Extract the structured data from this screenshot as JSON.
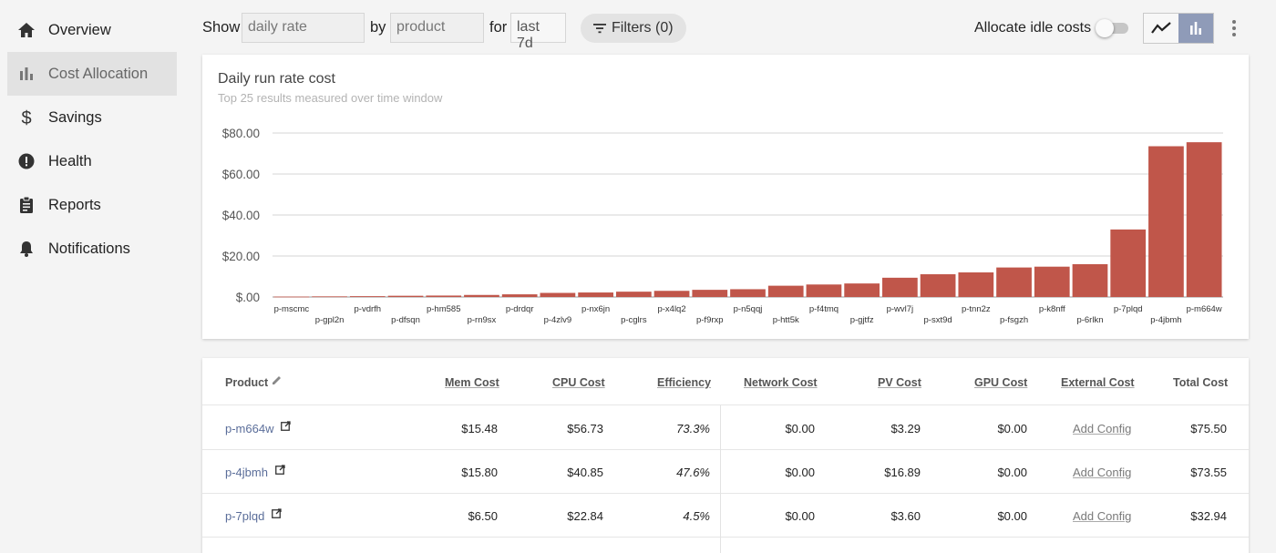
{
  "sidebar": {
    "items": [
      {
        "label": "Overview",
        "icon": "home-icon",
        "active": false
      },
      {
        "label": "Cost Allocation",
        "icon": "bar-chart-icon",
        "active": true
      },
      {
        "label": "Savings",
        "icon": "dollar-icon",
        "active": false
      },
      {
        "label": "Health",
        "icon": "alert-circle-icon",
        "active": false
      },
      {
        "label": "Reports",
        "icon": "clipboard-icon",
        "active": false
      },
      {
        "label": "Notifications",
        "icon": "bell-icon",
        "active": false
      }
    ]
  },
  "toolbar": {
    "show_label": "Show",
    "show_value": "daily rate",
    "by_label": "by",
    "by_value": "product",
    "for_label": "for",
    "for_value": "last 7d",
    "filters_label": "Filters (0)",
    "idle_label": "Allocate idle costs",
    "idle_enabled": false,
    "view_selected": "bar"
  },
  "chart": {
    "title": "Daily run rate cost",
    "subtitle": "Top 25 results measured over time window"
  },
  "chart_data": {
    "type": "bar",
    "categories": [
      "p-mscmc",
      "p-gpl2n",
      "p-vdrfh",
      "p-dfsqn",
      "p-hm585",
      "p-rn9sx",
      "p-drdqr",
      "p-4zlv9",
      "p-nx6jn",
      "p-cglrs",
      "p-x4lq2",
      "p-f9rxp",
      "p-n5qqj",
      "p-htt5k",
      "p-f4tmq",
      "p-gjtfz",
      "p-wvl7j",
      "p-sxt9d",
      "p-tnn2z",
      "p-fsgzh",
      "p-k8nff",
      "p-6rlkn",
      "p-7plqd",
      "p-4jbmh",
      "p-m664w"
    ],
    "values": [
      0.2,
      0.3,
      0.4,
      0.6,
      0.7,
      1.0,
      1.3,
      2.0,
      2.2,
      2.6,
      3.0,
      3.5,
      3.8,
      5.5,
      6.1,
      6.6,
      9.4,
      11.1,
      12.0,
      14.4,
      14.8,
      16.0,
      32.94,
      73.55,
      75.5
    ],
    "y_ticks": [
      "$.00",
      "$20.00",
      "$40.00",
      "$60.00",
      "$80.00"
    ],
    "ylim": [
      0,
      80
    ],
    "bar_color": "#c0564a",
    "grid": true,
    "xlabel": "",
    "ylabel": ""
  },
  "table": {
    "headers": {
      "product": "Product",
      "mem": "Mem Cost",
      "cpu": "CPU Cost",
      "eff": "Efficiency",
      "net": "Network Cost",
      "pv": "PV Cost",
      "gpu": "GPU Cost",
      "ext": "External Cost",
      "total": "Total Cost"
    },
    "rows": [
      {
        "product": "p-m664w",
        "mem": "$15.48",
        "cpu": "$56.73",
        "eff": "73.3%",
        "net": "$0.00",
        "pv": "$3.29",
        "gpu": "$0.00",
        "ext": "Add Config",
        "total": "$75.50"
      },
      {
        "product": "p-4jbmh",
        "mem": "$15.80",
        "cpu": "$40.85",
        "eff": "47.6%",
        "net": "$0.00",
        "pv": "$16.89",
        "gpu": "$0.00",
        "ext": "Add Config",
        "total": "$73.55"
      },
      {
        "product": "p-7plqd",
        "mem": "$6.50",
        "cpu": "$22.84",
        "eff": "4.5%",
        "net": "$0.00",
        "pv": "$3.60",
        "gpu": "$0.00",
        "ext": "Add Config",
        "total": "$32.94"
      }
    ]
  }
}
